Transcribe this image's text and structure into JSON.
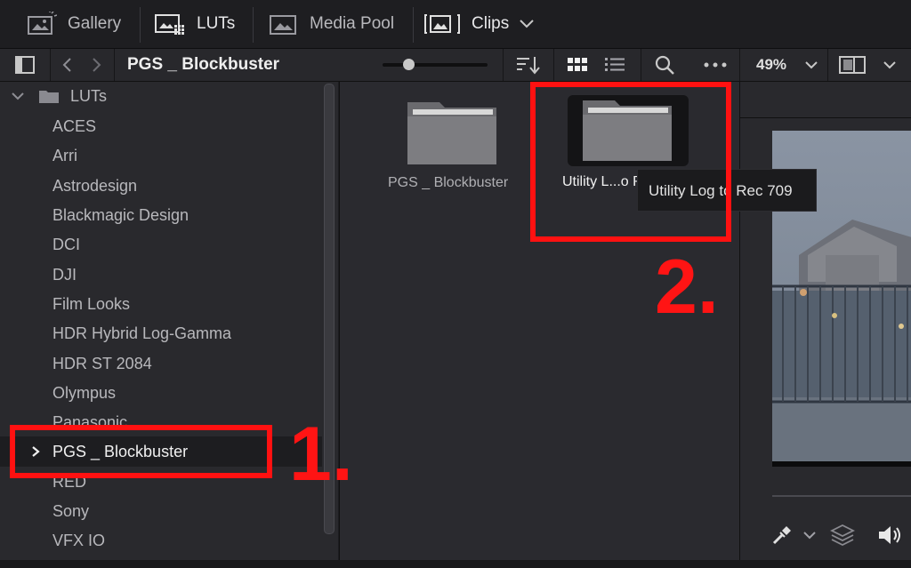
{
  "top_tabs": [
    {
      "label": "Gallery",
      "icon": "gallery-icon"
    },
    {
      "label": "LUTs",
      "icon": "luts-icon"
    },
    {
      "label": "Media Pool",
      "icon": "media-pool-icon"
    },
    {
      "label": "Clips",
      "icon": "clips-icon"
    }
  ],
  "toolbar": {
    "path_title": "PGS _ Blockbuster",
    "zoom": "49%"
  },
  "sidebar": {
    "root": "LUTs",
    "items": [
      "ACES",
      "Arri",
      "Astrodesign",
      "Blackmagic Design",
      "DCI",
      "DJI",
      "Film Looks",
      "HDR Hybrid Log-Gamma",
      "HDR ST 2084",
      "Olympus",
      "Panasonic",
      "PGS _ Blockbuster",
      "RED",
      "Sony",
      "VFX IO"
    ],
    "selected": "PGS _ Blockbuster"
  },
  "browser": {
    "folders": [
      {
        "label": "PGS _ Blockbuster"
      },
      {
        "label": "Utility L...o Rec 709"
      }
    ],
    "tooltip": "Utility Log to Rec 709"
  },
  "annotations": {
    "step1": "1.",
    "step2": "2."
  },
  "colors": {
    "accent_red": "#ff1111",
    "panel": "#29292d",
    "selected_row": "#1d1d20"
  }
}
